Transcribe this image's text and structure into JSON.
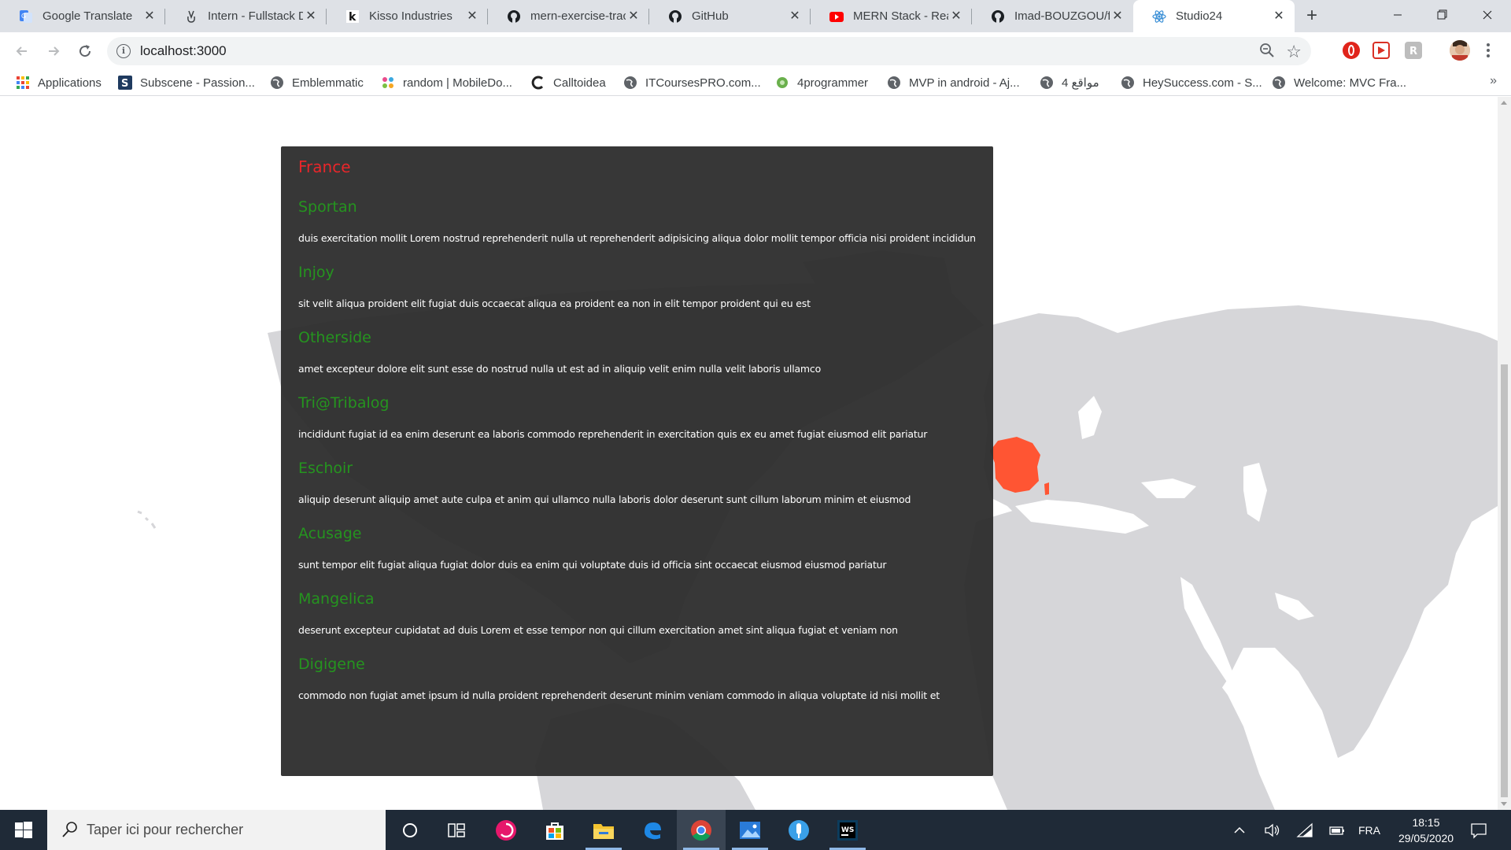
{
  "browser": {
    "tabs": [
      {
        "title": "Google Translate",
        "icon": "google-translate-icon"
      },
      {
        "title": "Intern - Fullstack D",
        "icon": "angellist-icon"
      },
      {
        "title": "Kisso Industries",
        "icon": "k-icon"
      },
      {
        "title": "mern-exercise-trac",
        "icon": "github-icon"
      },
      {
        "title": "GitHub",
        "icon": "github-icon"
      },
      {
        "title": "MERN Stack - Reac",
        "icon": "youtube-icon"
      },
      {
        "title": "Imad-BOUZGOU/f",
        "icon": "github-icon"
      },
      {
        "title": "Studio24",
        "icon": "react-icon",
        "active": true
      }
    ],
    "new_tab_label": "+",
    "url": "localhost:3000",
    "bookmarks": [
      {
        "label": "Applications",
        "icon": "apps-grid-icon"
      },
      {
        "label": "Subscene - Passion...",
        "icon": "subscene-icon"
      },
      {
        "label": "Emblemmatic",
        "icon": "globe-icon"
      },
      {
        "label": "random | MobileDo...",
        "icon": "mobiledo-icon"
      },
      {
        "label": "Calltoidea",
        "icon": "calltoidea-icon"
      },
      {
        "label": "ITCoursesPRO.com...",
        "icon": "globe-icon"
      },
      {
        "label": "4programmer",
        "icon": "4programmer-icon"
      },
      {
        "label": "MVP in android - Aj...",
        "icon": "globe-icon"
      },
      {
        "label": "مواقع 4",
        "icon": "globe-icon"
      },
      {
        "label": "HeySuccess.com - S...",
        "icon": "globe-icon"
      },
      {
        "label": "Welcome: MVC Fra...",
        "icon": "globe-icon"
      }
    ],
    "bookmarks_more": "»"
  },
  "panel": {
    "country": "France",
    "companies": [
      {
        "name": "Sportan",
        "description": "duis exercitation mollit Lorem nostrud reprehenderit nulla ut reprehenderit adipisicing aliqua dolor mollit tempor officia nisi proident incididunt ut nisi"
      },
      {
        "name": "Injoy",
        "description": "sit velit aliqua proident elit fugiat duis occaecat aliqua ea proident ea non in elit tempor proident qui eu est"
      },
      {
        "name": "Otherside",
        "description": "amet excepteur dolore elit sunt esse do nostrud nulla ut est ad in aliquip velit enim nulla velit laboris ullamco"
      },
      {
        "name": "Tri@Tribalog",
        "description": "incididunt fugiat id ea enim deserunt ea laboris commodo reprehenderit in exercitation quis ex eu amet fugiat eiusmod elit pariatur"
      },
      {
        "name": "Eschoir",
        "description": "aliquip deserunt aliquip amet aute culpa et anim qui ullamco nulla laboris dolor deserunt sunt cillum laborum minim et eiusmod"
      },
      {
        "name": "Acusage",
        "description": "sunt tempor elit fugiat aliqua fugiat dolor duis ea enim qui voluptate duis id officia sint occaecat eiusmod eiusmod pariatur"
      },
      {
        "name": "Mangelica",
        "description": "deserunt excepteur cupidatat ad duis Lorem et esse tempor non qui cillum exercitation amet sint aliqua fugiat et veniam non"
      },
      {
        "name": "Digigene",
        "description": "commodo non fugiat amet ipsum id nulla proident reprehenderit deserunt minim veniam commodo in aliqua voluptate id nisi mollit et"
      }
    ],
    "colors": {
      "country": "#e8262a",
      "company": "#25941f",
      "highlight": "#ff5533",
      "land": "#d6d6d9"
    }
  },
  "taskbar": {
    "search_placeholder": "Taper ici pour rechercher",
    "apps": [
      "cortana-icon",
      "task-view-icon",
      "app-red-icon",
      "store-icon",
      "file-explorer-icon",
      "edge-icon",
      "chrome-icon",
      "photos-icon",
      "app-blue-icon",
      "webstorm-icon"
    ],
    "language": "FRA",
    "time": "18:15",
    "date": "29/05/2020"
  }
}
